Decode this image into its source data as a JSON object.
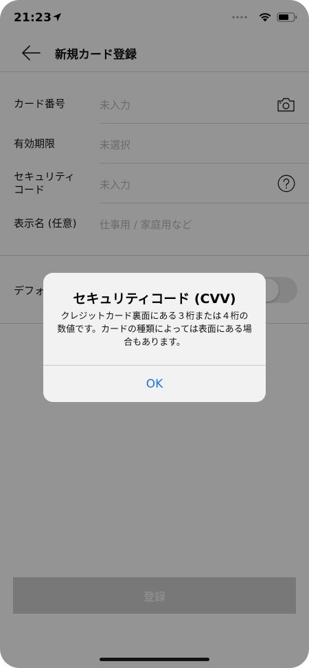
{
  "status_bar": {
    "time": "21:23",
    "icons": [
      "location-arrow-icon",
      "signal-dots-icon",
      "wifi-icon",
      "battery-icon"
    ]
  },
  "header": {
    "back_icon": "arrow-left-icon",
    "title": "新規カード登録"
  },
  "form": {
    "card_number": {
      "label": "カード番号",
      "placeholder": "未入力",
      "icon": "camera-icon"
    },
    "expiry": {
      "label": "有効期限",
      "placeholder": "未選択"
    },
    "security_code": {
      "label_line1": "セキュリティ",
      "label_line2": "コード",
      "placeholder": "未入力",
      "icon": "help-circle-icon"
    },
    "display_name": {
      "label": "表示名 (任意)",
      "placeholder": "仕事用 / 家庭用など"
    }
  },
  "default_row": {
    "label": "デフォ"
  },
  "submit_button": {
    "label": "登録"
  },
  "alert": {
    "title": "セキュリティコード (CVV)",
    "message": "クレジットカード裏面にある３桁または４桁の数値です。カードの種類によっては表面にある場合もあります。",
    "ok_label": "OK"
  },
  "colors": {
    "accent": "#1a73e8",
    "placeholder": "#b8b8b8",
    "disabled_button": "#cfcfcf",
    "overlay": "rgba(0,0,0,0.42)"
  }
}
